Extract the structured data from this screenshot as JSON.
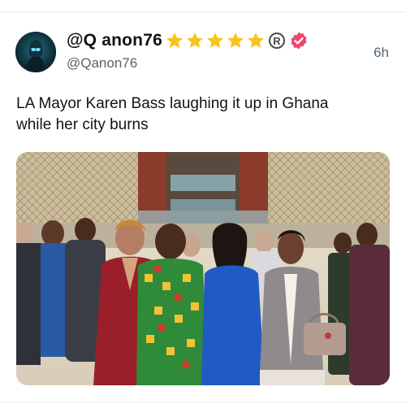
{
  "tweet": {
    "author": {
      "display_name": "@Q anon76",
      "handle": "@Qanon76",
      "avatar_icon": "masked-figure-avatar",
      "badges": [
        "star-icon",
        "star-icon",
        "star-icon",
        "star-icon",
        "star-icon",
        "registered-icon",
        "verified-badge-icon"
      ]
    },
    "timestamp": "6h",
    "text_lines": [
      "LA Mayor Karen Bass laughing it up in Ghana",
      "while her city burns"
    ],
    "media": {
      "type": "photo",
      "description_icon": "group-photo"
    }
  },
  "colors": {
    "star": "#f7c21b",
    "verified": "#f0476a",
    "secondary_text": "#536471",
    "primary_text": "#0f1419"
  }
}
